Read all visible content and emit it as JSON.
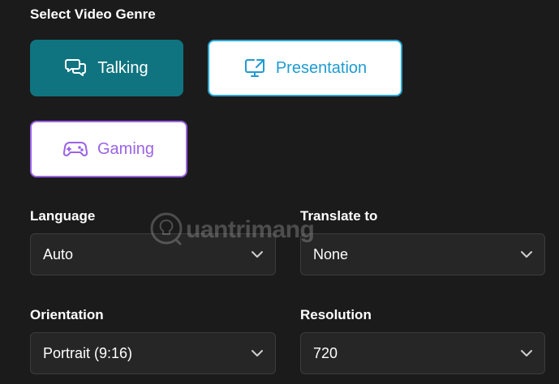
{
  "genre": {
    "title": "Select Video Genre",
    "options": [
      {
        "label": "Talking",
        "icon": "chat-bubbles-icon",
        "selected": true,
        "accent": "#0f7480"
      },
      {
        "label": "Presentation",
        "icon": "screen-share-icon",
        "selected": false,
        "accent": "#1f9bd1"
      },
      {
        "label": "Gaming",
        "icon": "gamepad-icon",
        "selected": false,
        "accent": "#9b63e6"
      }
    ]
  },
  "settings": {
    "language": {
      "label": "Language",
      "value": "Auto"
    },
    "translate": {
      "label": "Translate to",
      "value": "None"
    },
    "orientation": {
      "label": "Orientation",
      "value": "Portrait (9:16)"
    },
    "resolution": {
      "label": "Resolution",
      "value": "720"
    }
  },
  "watermark": {
    "text": "uantrimang"
  },
  "colors": {
    "background": "#1b1b1b",
    "select_background": "#262626",
    "select_border": "#3c3c3c"
  }
}
